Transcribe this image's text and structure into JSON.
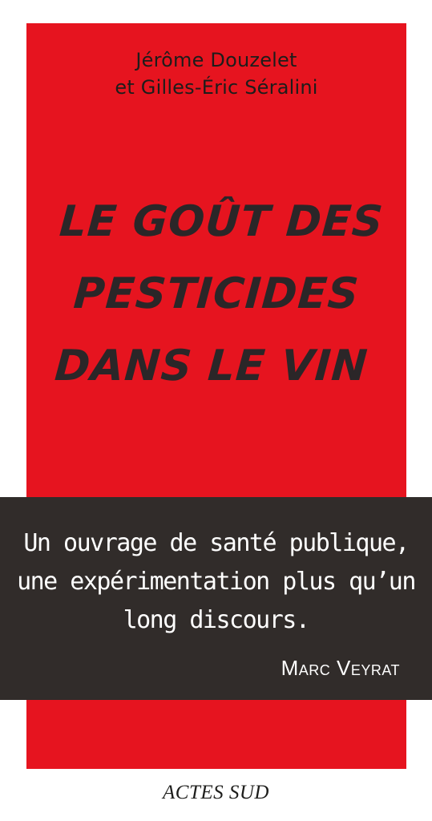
{
  "cover": {
    "background_color": "#e6141f",
    "band_color": "#312c2a",
    "authors": [
      "Jérôme Douzelet",
      "et Gilles-Éric Séralini"
    ],
    "title_lines": [
      "LE GOÛT DES",
      "PESTICIDES",
      "DANS LE VIN"
    ],
    "quote_lines": [
      "Un ouvrage de santé publique,",
      "une expérimentation plus qu’un",
      "long discours."
    ],
    "quote_author": "Marc Veyrat",
    "publisher": "ACTES SUD"
  }
}
